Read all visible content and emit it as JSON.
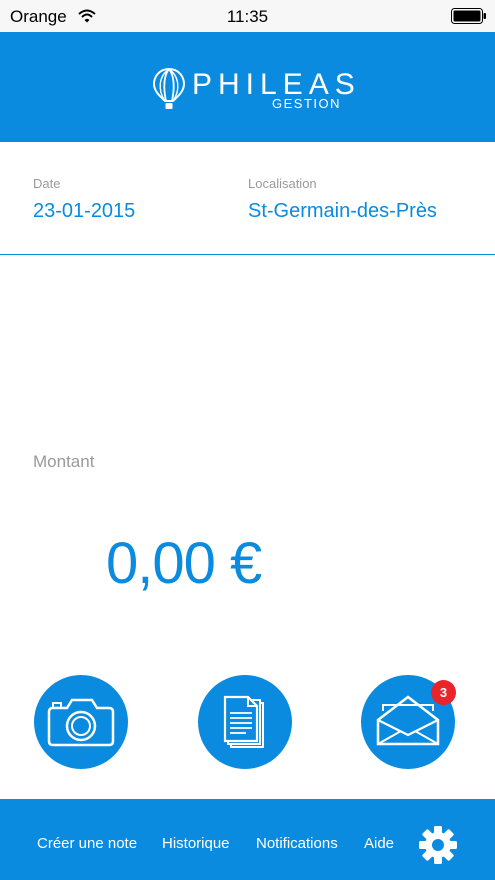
{
  "status_bar": {
    "carrier": "Orange",
    "time": "11:35"
  },
  "brand": {
    "name": "PHILEAS",
    "subtitle": "GESTION"
  },
  "fields": {
    "date_label": "Date",
    "date_value": "23-01-2015",
    "location_label": "Localisation",
    "location_value": "St-Germain-des-Près"
  },
  "amount": {
    "label": "Montant",
    "value": "0,00 €"
  },
  "actions": [
    {
      "name": "camera",
      "icon": "camera-icon"
    },
    {
      "name": "documents",
      "icon": "documents-icon"
    },
    {
      "name": "messages",
      "icon": "envelope-icon",
      "badge": "3"
    }
  ],
  "nav": {
    "create_note": "Créer une note",
    "history": "Historique",
    "notifications": "Notifications",
    "help": "Aide",
    "settings_icon": "gear-icon"
  },
  "colors": {
    "primary": "#0a8be0",
    "badge": "#e8252a",
    "muted": "#9a9a9a"
  }
}
